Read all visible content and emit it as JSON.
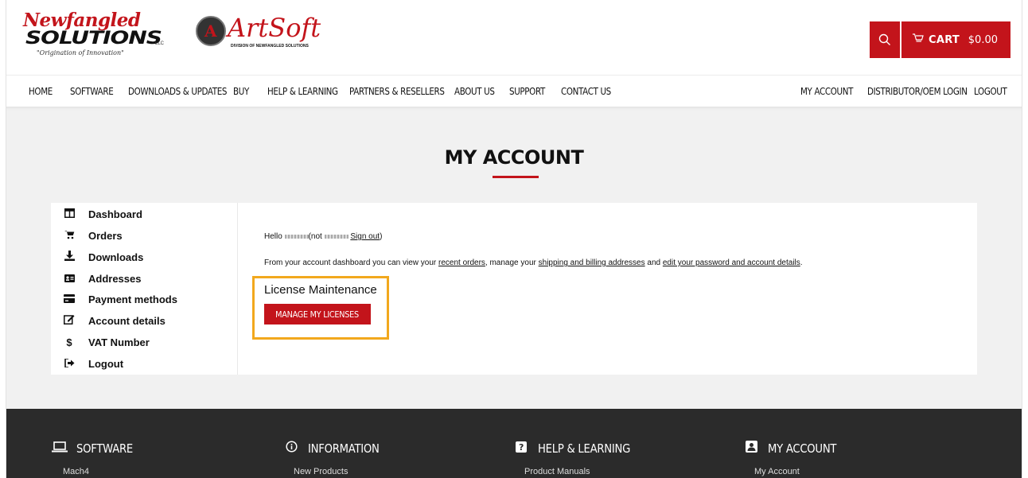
{
  "logos": {
    "newfangled_top": "Newfangled",
    "newfangled_main": "SOLUTIONS",
    "newfangled_llc": "LLC",
    "newfangled_tag": "\"Origination of Innovation\"",
    "artsoft_word": "ArtSoft",
    "artsoft_division": "DIVISION OF NEWFANGLED SOLUTIONS"
  },
  "header": {
    "cart_label": "CART",
    "cart_total": "$0.00"
  },
  "nav": {
    "left": [
      "HOME",
      "SOFTWARE",
      "DOWNLOADS & UPDATES",
      "BUY",
      "HELP & LEARNING",
      "PARTNERS & RESELLERS",
      "ABOUT US",
      "SUPPORT",
      "CONTACT US"
    ],
    "right": [
      "MY ACCOUNT",
      "DISTRIBUTOR/OEM LOGIN",
      "LOGOUT"
    ]
  },
  "page": {
    "title": "MY ACCOUNT"
  },
  "sidebar": {
    "items": [
      {
        "label": "Dashboard",
        "icon": "dashboard-icon"
      },
      {
        "label": "Orders",
        "icon": "cart-icon"
      },
      {
        "label": "Downloads",
        "icon": "download-icon"
      },
      {
        "label": "Addresses",
        "icon": "address-card-icon"
      },
      {
        "label": "Payment methods",
        "icon": "credit-card-icon"
      },
      {
        "label": "Account details",
        "icon": "edit-icon"
      },
      {
        "label": "VAT Number",
        "icon": "dollar-icon"
      },
      {
        "label": "Logout",
        "icon": "sign-out-icon"
      }
    ]
  },
  "dashboard": {
    "hello_prefix": "Hello",
    "not_prefix": "(not",
    "sign_out": "Sign out",
    "close_paren": ")",
    "desc_1": "From your account dashboard you can view your ",
    "recent_orders": "recent orders",
    "desc_2": ", manage your ",
    "addresses_link": "shipping and billing addresses",
    "desc_3": " and ",
    "account_link": "edit your password and account details",
    "desc_4": "."
  },
  "license": {
    "title": "License Maintenance",
    "button": "MANAGE MY LICENSES"
  },
  "footer": {
    "columns": [
      {
        "heading": "SOFTWARE",
        "icon": "laptop-icon",
        "first_link": "Mach4"
      },
      {
        "heading": "INFORMATION",
        "icon": "info-circle-icon",
        "first_link": "New Products"
      },
      {
        "heading": "HELP & LEARNING",
        "icon": "question-icon",
        "first_link": "Product Manuals"
      },
      {
        "heading": "MY ACCOUNT",
        "icon": "account-box-icon",
        "first_link": "My Account"
      }
    ]
  },
  "colors": {
    "brand_red": "#c3141b",
    "highlight": "#f2a81d",
    "footer_bg": "#2b2b2b"
  }
}
